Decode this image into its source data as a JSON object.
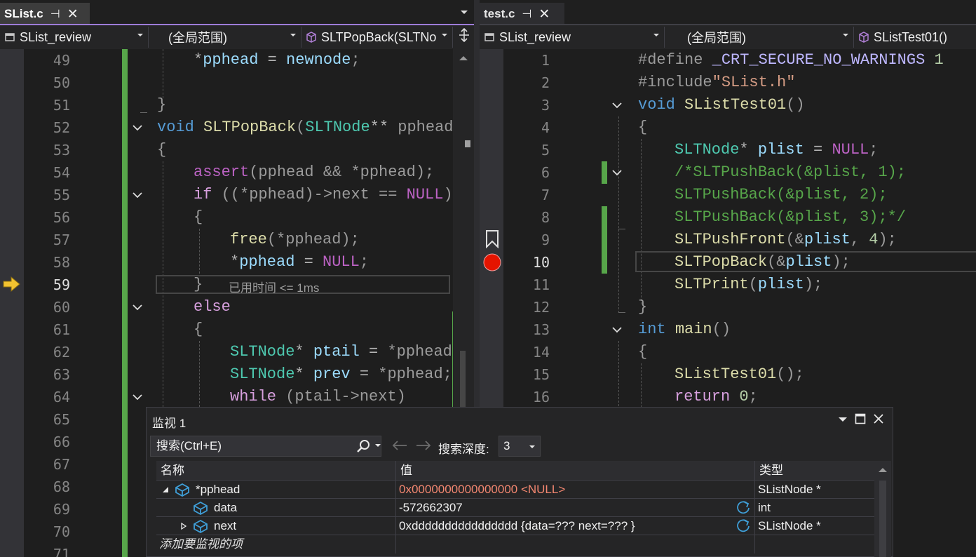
{
  "left_tab": {
    "title": "SList.c",
    "pin": "⊣",
    "close": "✕"
  },
  "right_tab": {
    "title": "test.c",
    "pin": "⊣",
    "close": "✕"
  },
  "left_nav": {
    "project": "SList_review",
    "scope": "(全局范围)",
    "member": "SLTPopBack(SLTNo"
  },
  "right_nav": {
    "project": "SList_review",
    "scope": "(全局范围)",
    "member": "SListTest01()"
  },
  "left_lines": [
    "49",
    "50",
    "51",
    "52",
    "53",
    "54",
    "55",
    "56",
    "57",
    "58",
    "59",
    "60",
    "61",
    "62",
    "63",
    "64",
    "65",
    "66",
    "67",
    "68",
    "69",
    "70",
    "71"
  ],
  "right_lines": [
    "1",
    "2",
    "3",
    "4",
    "5",
    "6",
    "7",
    "8",
    "9",
    "10",
    "11",
    "12",
    "13",
    "14",
    "15",
    "16"
  ],
  "elapsed_hint": "已用时间 <= 1ms",
  "watch": {
    "title": "监视 1",
    "search_placeholder": "搜索(Ctrl+E)",
    "depth_label": "搜索深度:",
    "depth_value": "3",
    "columns": {
      "name": "名称",
      "value": "值",
      "type": "类型"
    },
    "rows": [
      {
        "name": "*pphead",
        "value": "0x0000000000000000 <NULL>",
        "type": "SListNode *"
      },
      {
        "name": "data",
        "value": "-572662307",
        "type": "int"
      },
      {
        "name": "next",
        "value": "0xdddddddddddddddd {data=??? next=??? }",
        "type": "SListNode *"
      }
    ],
    "add_item": "添加要监视的项"
  }
}
